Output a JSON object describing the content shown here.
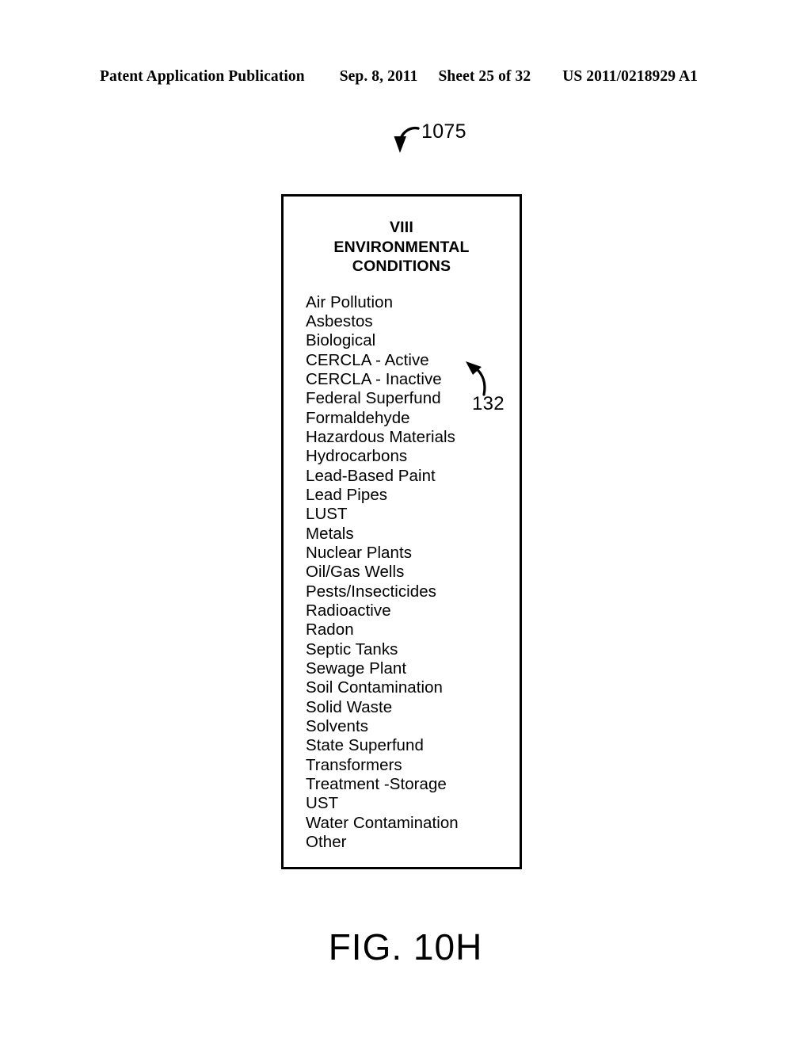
{
  "header": {
    "publication": "Patent Application Publication",
    "date": "Sep. 8, 2011",
    "sheet": "Sheet 25 of 32",
    "patent_number": "US 2011/0218929 A1"
  },
  "callouts": {
    "box_reference": "1075",
    "item_reference": "132"
  },
  "box": {
    "title_lines": [
      "VIII",
      "ENVIRONMENTAL",
      "CONDITIONS"
    ],
    "items": [
      "Air Pollution",
      "Asbestos",
      "Biological",
      "CERCLA - Active",
      "CERCLA - Inactive",
      "Federal Superfund",
      "Formaldehyde",
      "Hazardous Materials",
      "Hydrocarbons",
      "Lead-Based Paint",
      "Lead Pipes",
      "LUST",
      "Metals",
      "Nuclear Plants",
      "Oil/Gas Wells",
      "Pests/Insecticides",
      "Radioactive",
      "Radon",
      "Septic Tanks",
      "Sewage Plant",
      "Soil Contamination",
      "Solid Waste",
      "Solvents",
      "State Superfund",
      "Transformers",
      "Treatment -Storage",
      "UST",
      "Water Contamination",
      "Other"
    ]
  },
  "caption": "FIG. 10H",
  "colors": {
    "ink": "#000000",
    "page": "#ffffff"
  }
}
